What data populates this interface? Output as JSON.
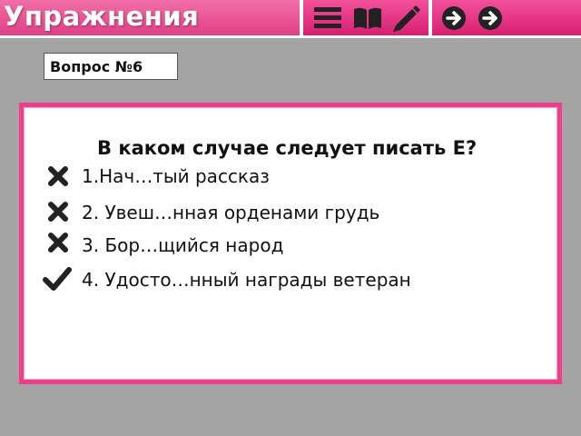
{
  "header": {
    "title": "Упражнения",
    "nav_icons": [
      "menu-icon",
      "book-icon",
      "pencil-icon"
    ],
    "arrow_icons": [
      "back-arrow-icon",
      "forward-arrow-icon"
    ]
  },
  "question": {
    "badge": "Вопрос №6",
    "prompt": "В каком случае следует писать Е?",
    "answers": [
      {
        "text": "1.Нач…тый рассказ",
        "mark": "cross-icon"
      },
      {
        "text": "2. Увеш…нная орденами грудь",
        "mark": "cross-icon"
      },
      {
        "text": "3. Бор…щийся народ",
        "mark": "cross-icon"
      },
      {
        "text": "4. Удосто…нный награды ветеран",
        "mark": "checkmark-icon"
      }
    ]
  },
  "colors": {
    "accent": "#e03f86",
    "border": "#ee3f8c",
    "background": "#a3a3a3"
  }
}
